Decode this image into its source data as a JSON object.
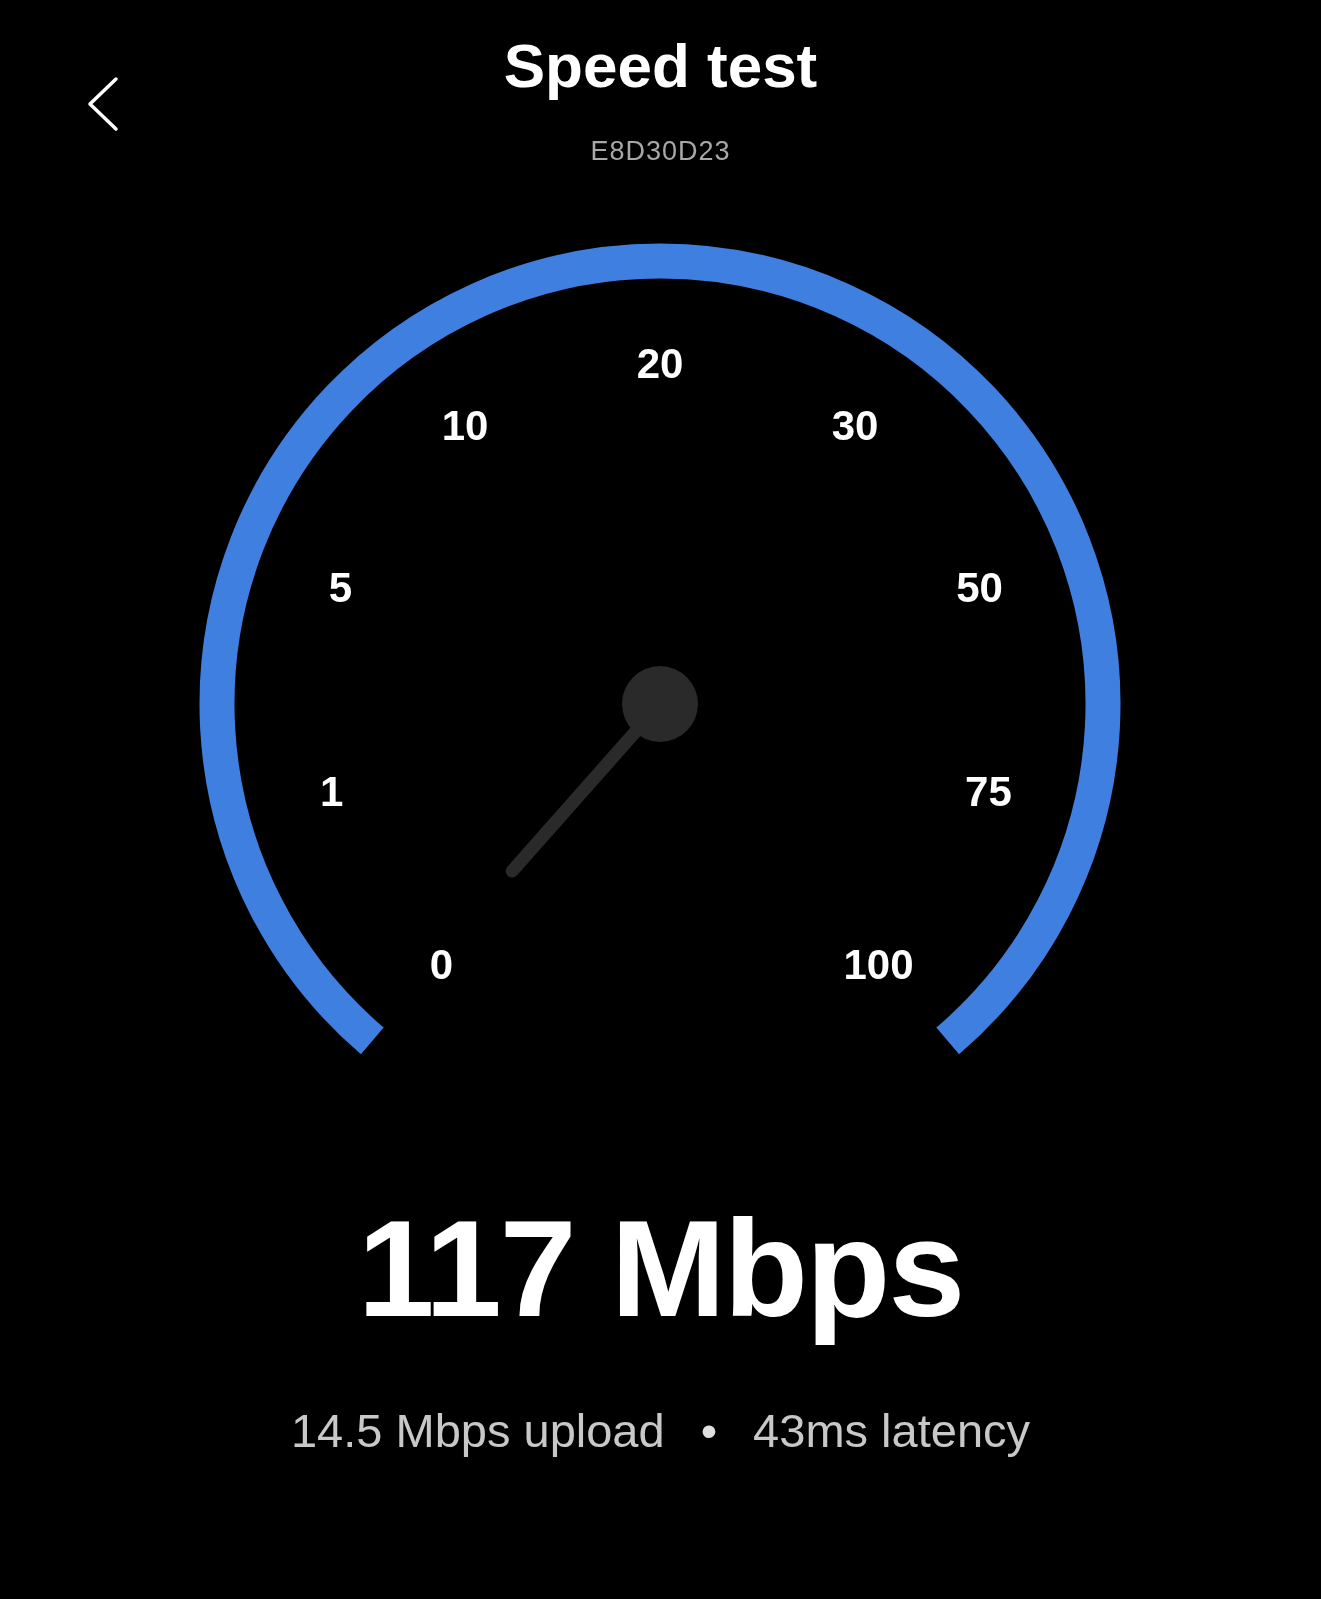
{
  "header": {
    "title": "Speed test",
    "subtitle": "E8D30D23"
  },
  "gauge": {
    "ticks": [
      "0",
      "1",
      "5",
      "10",
      "20",
      "30",
      "50",
      "75",
      "100"
    ]
  },
  "result": {
    "speed": "117 Mbps",
    "upload": "14.5 Mbps upload",
    "separator": "•",
    "latency": "43ms latency"
  }
}
